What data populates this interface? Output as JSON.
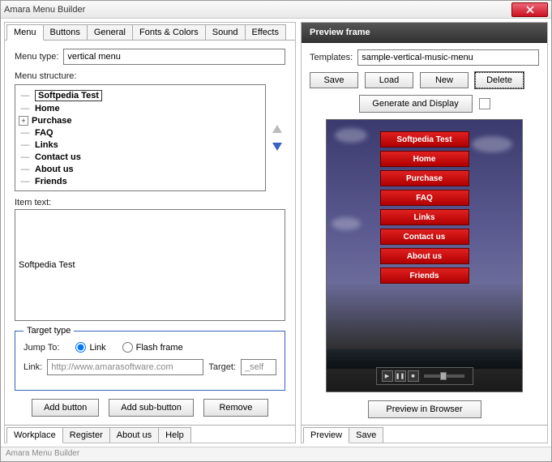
{
  "window": {
    "title": "Amara Menu Builder"
  },
  "left": {
    "tabs": [
      "Menu",
      "Buttons",
      "General",
      "Fonts & Colors",
      "Sound",
      "Effects"
    ],
    "active_tab": 0,
    "menu_type_label": "Menu type:",
    "menu_type_value": "vertical menu",
    "structure_label": "Menu structure:",
    "tree_items": [
      {
        "label": "Softpedia Test",
        "selected": true,
        "expandable": false
      },
      {
        "label": "Home",
        "selected": false,
        "expandable": false
      },
      {
        "label": "Purchase",
        "selected": false,
        "expandable": true
      },
      {
        "label": "FAQ",
        "selected": false,
        "expandable": false
      },
      {
        "label": "Links",
        "selected": false,
        "expandable": false
      },
      {
        "label": "Contact us",
        "selected": false,
        "expandable": false
      },
      {
        "label": "About us",
        "selected": false,
        "expandable": false
      },
      {
        "label": "Friends",
        "selected": false,
        "expandable": false
      }
    ],
    "item_text_label": "Item text:",
    "item_text_value": "Softpedia Test",
    "target_type_legend": "Target type",
    "jump_to_label": "Jump To:",
    "radio_link": "Link",
    "radio_flash": "Flash frame",
    "link_label": "Link:",
    "link_value": "http://www.amarasoftware.com",
    "target_label": "Target:",
    "target_value": "_self",
    "btn_add": "Add button",
    "btn_add_sub": "Add sub-button",
    "btn_remove": "Remove",
    "bottom_tabs": [
      "Workplace",
      "Register",
      "About us",
      "Help"
    ]
  },
  "right": {
    "header": "Preview frame",
    "templates_label": "Templates:",
    "templates_value": "sample-vertical-music-menu",
    "btn_save": "Save",
    "btn_load": "Load",
    "btn_new": "New",
    "btn_delete": "Delete",
    "btn_generate": "Generate and Display",
    "menu_buttons": [
      "Softpedia Test",
      "Home",
      "Purchase",
      "FAQ",
      "Links",
      "Contact us",
      "About us",
      "Friends"
    ],
    "btn_preview_browser": "Preview in Browser",
    "bottom_tabs": [
      "Preview",
      "Save"
    ]
  },
  "status": "Amara Menu Builder"
}
